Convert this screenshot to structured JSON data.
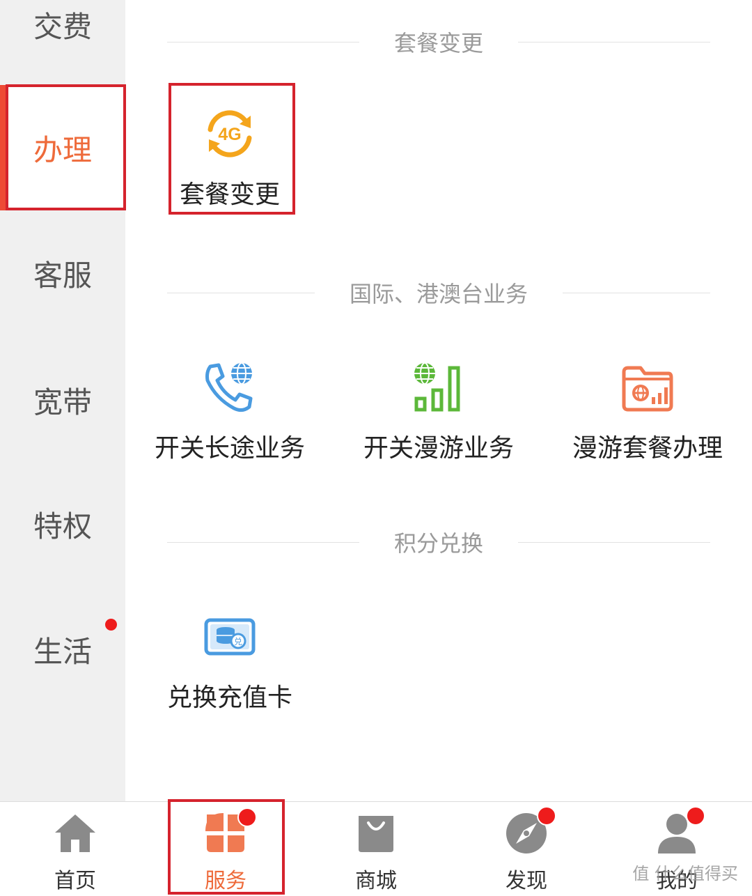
{
  "sidebar": {
    "items": [
      {
        "label": "交费"
      },
      {
        "label": "办理"
      },
      {
        "label": "客服"
      },
      {
        "label": "宽带"
      },
      {
        "label": "特权"
      },
      {
        "label": "生活"
      }
    ],
    "active_index": 1,
    "active_color": "#ee6a3a"
  },
  "sections": [
    {
      "title": "套餐变更",
      "tiles": [
        {
          "label": "套餐变更",
          "icon": "4g-cycle-icon"
        }
      ]
    },
    {
      "title": "国际、港澳台业务",
      "tiles": [
        {
          "label": "开关长途业务",
          "icon": "phone-globe-icon"
        },
        {
          "label": "开关漫游业务",
          "icon": "globe-signal-icon"
        },
        {
          "label": "漫游套餐办理",
          "icon": "folder-globe-icon"
        }
      ]
    },
    {
      "title": "积分兑换",
      "tiles": [
        {
          "label": "兑换充值卡",
          "icon": "card-exchange-icon"
        }
      ]
    }
  ],
  "tabbar": {
    "items": [
      {
        "label": "首页",
        "icon": "home-icon"
      },
      {
        "label": "服务",
        "icon": "clover-icon"
      },
      {
        "label": "商城",
        "icon": "shopping-bag-icon"
      },
      {
        "label": "发现",
        "icon": "compass-icon"
      },
      {
        "label": "我的",
        "icon": "person-icon"
      }
    ],
    "active_index": 1
  },
  "watermark": "值 什么值得买",
  "colors": {
    "accent": "#ee6a3a",
    "highlight_box": "#d5232d",
    "badge": "#ee1c1c"
  }
}
